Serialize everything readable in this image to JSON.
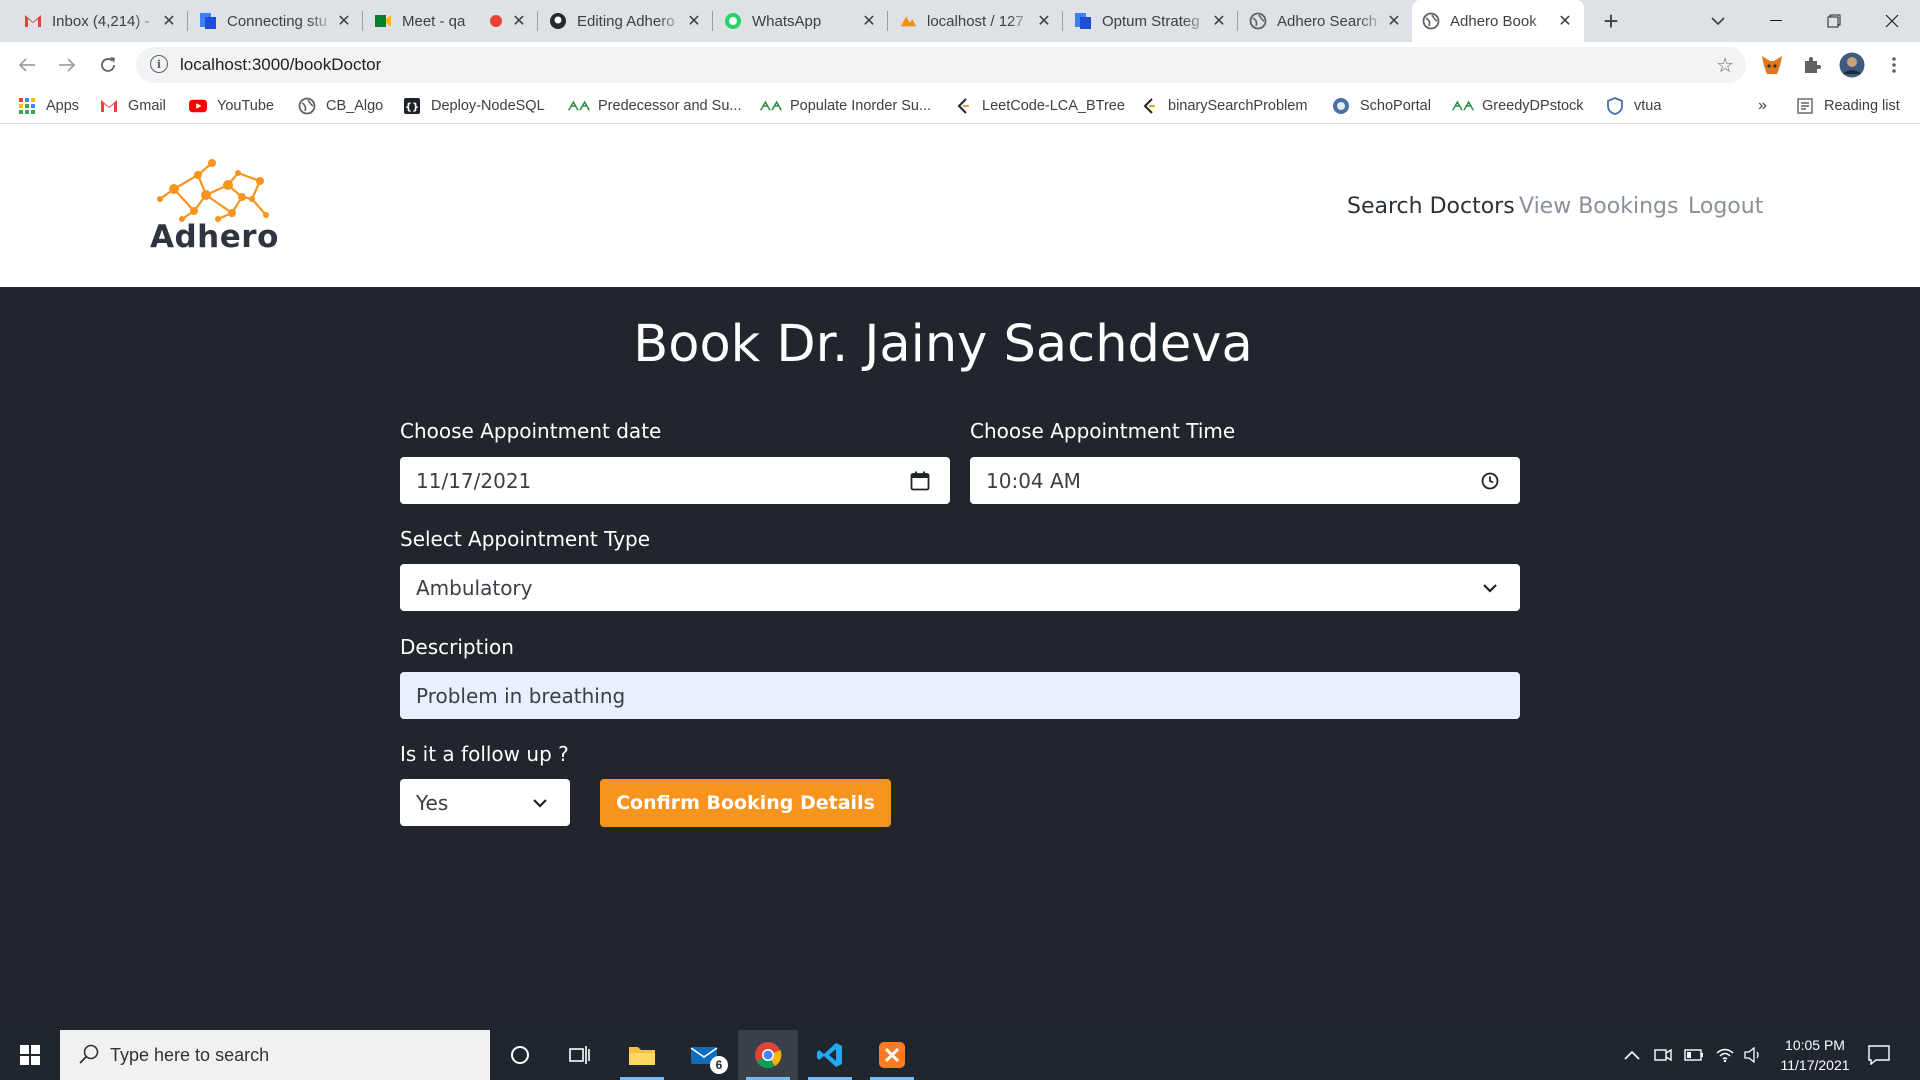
{
  "browser": {
    "tabs": [
      {
        "title": "Inbox (4,214) - ",
        "icon": "gmail-icon"
      },
      {
        "title": "Connecting stu",
        "icon": "doc-icon"
      },
      {
        "title": "Meet - qa",
        "icon": "meet-icon"
      },
      {
        "title": "Editing Adhero",
        "icon": "github-icon"
      },
      {
        "title": "WhatsApp",
        "icon": "whatsapp-icon"
      },
      {
        "title": "localhost / 127",
        "icon": "pma-icon"
      },
      {
        "title": "Optum Strateg",
        "icon": "doc-icon"
      },
      {
        "title": "Adhero Search",
        "icon": "globe-icon"
      },
      {
        "title": "Adhero Book",
        "icon": "globe-icon"
      }
    ],
    "url": "localhost:3000/bookDoctor",
    "bookmarks": [
      {
        "label": "Apps"
      },
      {
        "label": "Gmail"
      },
      {
        "label": "YouTube"
      },
      {
        "label": "CB_Algo"
      },
      {
        "label": "Deploy-NodeSQL"
      },
      {
        "label": "Predecessor and Su..."
      },
      {
        "label": "Populate Inorder Su..."
      },
      {
        "label": "LeetCode-LCA_BTree"
      },
      {
        "label": "binarySearchProblem"
      },
      {
        "label": "SchoPortal"
      },
      {
        "label": "GreedyDPstock"
      },
      {
        "label": "vtua"
      }
    ],
    "more_bookmarks": "»",
    "reading_list": "Reading list"
  },
  "app": {
    "logo_text": "Adhero",
    "nav": {
      "search": "Search Doctors",
      "bookings": "View Bookings",
      "logout": "Logout"
    }
  },
  "form": {
    "title": "Book Dr. Jainy Sachdeva",
    "date_label": "Choose Appointment date",
    "date_value": "11/17/2021",
    "time_label": "Choose Appointment Time",
    "time_value": "10:04 AM",
    "type_label": "Select Appointment Type",
    "type_value": "Ambulatory",
    "desc_label": "Description",
    "desc_value": "Problem in breathing",
    "followup_label": "Is it a follow up ?",
    "followup_value": "Yes",
    "confirm_label": "Confirm Booking Details"
  },
  "taskbar": {
    "search_placeholder": "Type here to search",
    "mail_badge": "6",
    "time": "10:05 PM",
    "date": "11/17/2021"
  },
  "colors": {
    "main_bg": "#21252c",
    "accent": "#f7941d",
    "logo_orange": "#f7941d"
  }
}
